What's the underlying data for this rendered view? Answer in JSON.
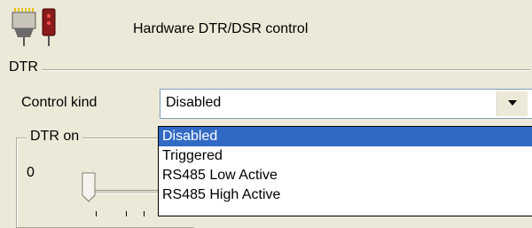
{
  "header": {
    "title": "Hardware DTR/DSR control",
    "icon": "serial-connector-icon"
  },
  "dtr_section": {
    "legend": "DTR",
    "control_kind_label": "Control kind",
    "control_kind_value": "Disabled",
    "dropdown_options": [
      {
        "label": "Disabled",
        "selected": true
      },
      {
        "label": "Triggered",
        "selected": false
      },
      {
        "label": "RS485 Low Active",
        "selected": false
      },
      {
        "label": "RS485 High Active",
        "selected": false
      }
    ]
  },
  "dtr_on_group": {
    "legend": "DTR on",
    "scale_min_label": "0"
  },
  "colors": {
    "window_bg": "#ece9d8",
    "selection_bg": "#316ac5",
    "selection_fg": "#ffffff"
  }
}
